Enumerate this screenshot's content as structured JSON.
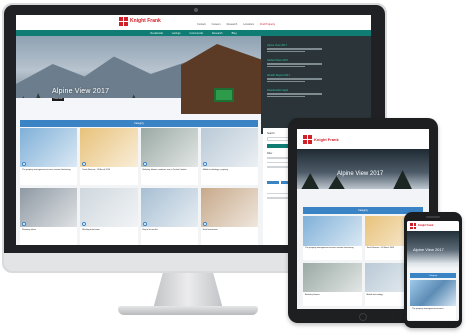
{
  "brand": {
    "name": "Knight Frank",
    "mark_color": "#d2202a"
  },
  "desktop": {
    "top_links": [
      "Contact",
      "Careers",
      "Research",
      "Locations",
      "Find Property"
    ],
    "nav": [
      "Residential",
      "Lettings",
      "Commercial",
      "Research",
      "Blog"
    ],
    "hero": {
      "title": "Alpine View 2017",
      "button": "Read more"
    },
    "sidebar": [
      {
        "title": "Alpine View 2017"
      },
      {
        "title": "Global Cities 2017"
      },
      {
        "title": "Wealth Report 2017"
      },
      {
        "title": "Residential Insight"
      }
    ],
    "band": "Category",
    "cards": [
      {
        "caption": "The property management services remote functioning",
        "color": "#7fb0d8"
      },
      {
        "caption": "Touch Beacon - 10 March 2014",
        "color": "#e8c27a"
      },
      {
        "caption": "Berkeley Homes continues rise in Central London",
        "color": "#9aa9a3"
      },
      {
        "caption": "Mobile technology - property",
        "color": "#b9c9d6"
      },
      {
        "caption": "Planning reform",
        "color": "#8f99a3"
      },
      {
        "caption": "Working from home",
        "color": "#cfd8de"
      },
      {
        "caption": "Buy to let market",
        "color": "#a7bfd3"
      },
      {
        "caption": "Hotel investment",
        "color": "#c7a98a"
      }
    ],
    "right_panel": {
      "label_1": "Search",
      "label_2": "Filter"
    }
  },
  "tablet": {
    "hero_title": "Alpine View 2017",
    "band": "Category",
    "cards": [
      {
        "caption": "The property management services remote functioning",
        "color": "#7fb0d8"
      },
      {
        "caption": "Touch Beacon - 10 March 2014",
        "color": "#e8c27a"
      },
      {
        "caption": "Berkeley Homes",
        "color": "#9aa9a3"
      },
      {
        "caption": "Mobile technology",
        "color": "#b9c9d6"
      }
    ]
  },
  "phone": {
    "hero_title": "Alpine View 2017",
    "band": "Category",
    "card_caption": "The property management services"
  }
}
